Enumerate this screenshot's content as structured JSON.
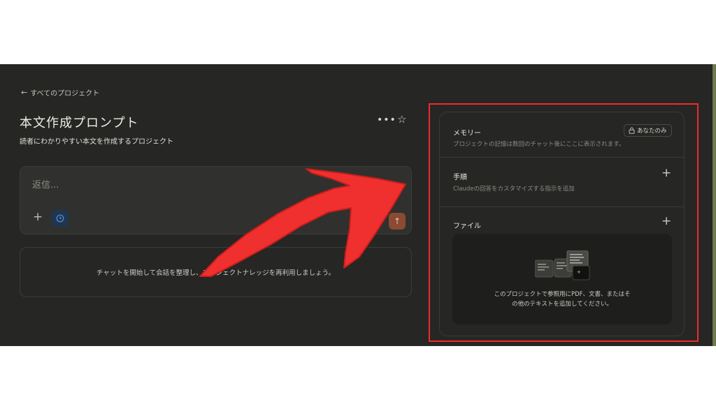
{
  "nav": {
    "back_label": "すべてのプロジェクト"
  },
  "project": {
    "title": "本文作成プロンプト",
    "description": "読者にわかりやすい本文を作成するプロジェクト"
  },
  "composer": {
    "placeholder": "返信..."
  },
  "empty_state": {
    "text": "チャットを開始して会話を整理し、プロジェクトナレッジを再利用しましょう。"
  },
  "sidebar": {
    "memory": {
      "title": "メモリー",
      "description": "プロジェクトの記憶は数回のチャット後にここに表示されます。",
      "badge": "あなたのみ"
    },
    "instructions": {
      "title": "手順",
      "description": "Claudeの回答をカスタマイズする指示を追加"
    },
    "files": {
      "title": "ファイル",
      "empty_line1": "このプロジェクトで参照用にPDF、文書、またはそ",
      "empty_line2": "の他のテキストを追加してください。"
    }
  },
  "colors": {
    "background": "#262624",
    "highlight": "#ee2b2b",
    "send_button": "#8a4a33",
    "arrow": "#f0302e"
  }
}
